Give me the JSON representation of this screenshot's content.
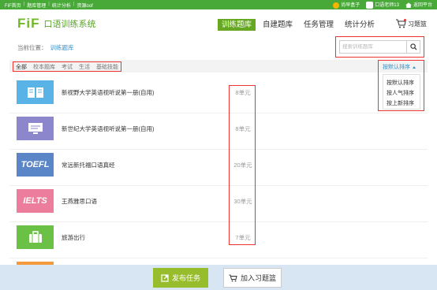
{
  "topbar": {
    "links": [
      "FiF首页",
      "题库管理",
      "统计分析",
      "资源oof"
    ],
    "user": "尚早盒子",
    "teacher": "口语老师13",
    "back": "返回平台"
  },
  "header": {
    "logo": "FiF",
    "app_name": "口语训练系统",
    "nav": [
      "训练题库",
      "自建题库",
      "任务管理",
      "统计分析"
    ],
    "active_nav": "训练题库",
    "basket": "习题篮"
  },
  "breadcrumb": {
    "label": "当前位置：",
    "current": "训练题库"
  },
  "search": {
    "placeholder": "搜索训练题库"
  },
  "categories": [
    "全部",
    "校本题库",
    "考试",
    "生活",
    "基础技能"
  ],
  "sort": {
    "current": "按默认排序",
    "options": [
      "按默认排序",
      "按人气排序",
      "按上新排序"
    ]
  },
  "items": [
    {
      "title": "新视野大学英语视听说第一册(自用)",
      "units": "8单元",
      "thumb_text": "",
      "color": "#5ab3e6"
    },
    {
      "title": "新世纪大学英语视听说第一册(自用)",
      "units": "8单元",
      "thumb_text": "",
      "color": "#8c86cc"
    },
    {
      "title": "常远新托福口语真经",
      "units": "20单元",
      "thumb_text": "TOEFL",
      "color": "#5a86c8"
    },
    {
      "title": "王燕雅思口语",
      "units": "30单元",
      "thumb_text": "IELTS",
      "color": "#ec7d9c"
    },
    {
      "title": "旅游出行",
      "units": "7单元",
      "thumb_text": "",
      "color": "#6bc046"
    }
  ],
  "partial_item_color": "#f39a3c",
  "footer": {
    "publish": "发布任务",
    "add_basket": "加入习题篮"
  },
  "colors": {
    "brand_green": "#48a838",
    "highlight_red": "#e33",
    "link_blue": "#3c8fc6"
  }
}
